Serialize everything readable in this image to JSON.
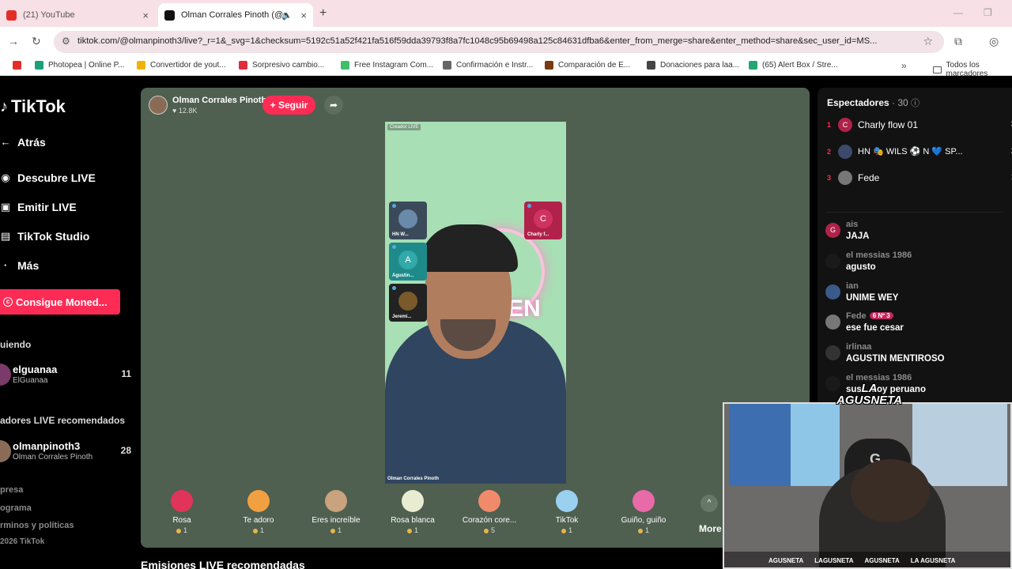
{
  "browser": {
    "tabs": [
      {
        "title": "(21) YouTube",
        "close": "×"
      },
      {
        "title": "Olman Corrales Pinoth (@o",
        "close": "×",
        "audio_icon": "speaker-icon"
      }
    ],
    "new_tab": "+",
    "window_controls": {
      "minimize": "—",
      "restore": "❐"
    },
    "url": "tiktok.com/@olmanpinoth3/live?_r=1&_svg=1&checksum=5192c51a52f421fa516f59dda39793f8a7fc1048c95b69498a125c84631dfba6&enter_from_merge=share&enter_method=share&sec_user_id=MS...",
    "bookmarks": [
      {
        "label": "",
        "color": "#e52d27",
        "icon": "youtube-icon"
      },
      {
        "label": "Photopea | Online P...",
        "color": "#1aa179"
      },
      {
        "label": "Convertidor de yout...",
        "color": "#f0b400"
      },
      {
        "label": "Sorpresivo cambio...",
        "color": "#e12c3c"
      },
      {
        "label": "Free Instagram Com...",
        "color": "#3fbf6a"
      },
      {
        "label": "Confirmación e Instr...",
        "color": "#666666"
      },
      {
        "label": "Comparación de E...",
        "color": "#7a3b10"
      },
      {
        "label": "Donaciones para laa...",
        "color": "#444444"
      },
      {
        "label": "(65) Alert Box / Stre...",
        "color": "#23a574"
      }
    ],
    "bookmarks_more": "»",
    "bookmarks_folder": "Todos los marcadores"
  },
  "sidebar": {
    "logo": "TikTok",
    "nav": [
      {
        "label": "Atrás",
        "icon": "arrow-left-icon"
      },
      {
        "label": "Descubre LIVE",
        "icon": "live-icon"
      },
      {
        "label": "Emitir LIVE",
        "icon": "camera-icon"
      },
      {
        "label": "TikTok Studio",
        "icon": "studio-icon"
      },
      {
        "label": "Más",
        "icon": "more-icon"
      }
    ],
    "coins_button": "Consigue Moned...",
    "following_title": "uiendo",
    "following": [
      {
        "name": "elguanaa",
        "handle": "ElGuanaa",
        "count": "11"
      }
    ],
    "recommended_title": "adores LIVE recomendados",
    "recommended": [
      {
        "name": "olmanpinoth3",
        "handle": "Olman Corrales Pinoth",
        "count": "28"
      }
    ],
    "footer": [
      "presa",
      "ograma",
      "rminos y políticas",
      "2026 TikTok"
    ]
  },
  "live": {
    "host_name": "Olman Corrales Pinoth",
    "likes": "♥ 12.8K",
    "follow_label": "+ Seguir",
    "stream_badge": "Creador LIVE",
    "stream_caption": "Olman Corrales Pinoth",
    "brand_text": "MEN",
    "guests": [
      {
        "label": "HN W...",
        "initial": "",
        "color": "#3b4a5a"
      },
      {
        "label": "Charly f...",
        "initial": "C",
        "color": "#b0224a"
      },
      {
        "label": "Agustin...",
        "initial": "A",
        "color": "#1f8a8a"
      },
      {
        "label": "Jeremi...",
        "initial": "",
        "color": "#222222"
      }
    ],
    "gifts": [
      {
        "name": "Rosa",
        "price": "1",
        "color": "#e0345a"
      },
      {
        "name": "Te adoro",
        "price": "1",
        "color": "#f0a040"
      },
      {
        "name": "Eres increíble",
        "price": "1",
        "color": "#c9a27e"
      },
      {
        "name": "Rosa blanca",
        "price": "1",
        "color": "#e8ecd0"
      },
      {
        "name": "Corazón core...",
        "price": "5",
        "color": "#f08a6a"
      },
      {
        "name": "TikTok",
        "price": "1",
        "color": "#9ad0f0"
      },
      {
        "name": "Guiño, guiño",
        "price": "1",
        "color": "#e86aa8"
      }
    ],
    "gifts_up": "^",
    "gifts_more": "More",
    "recommended_title": "Emisiones LIVE recomendadas"
  },
  "viewers": {
    "title": "Espectadores",
    "count": "· 30",
    "top": [
      {
        "rank": "1",
        "name": "Charly flow 01",
        "initial": "C",
        "color": "#b0224a",
        "score": "3"
      },
      {
        "rank": "2",
        "name": "HN 🎭 WILS ⚽ N 💙 SP...",
        "initial": "",
        "color": "#3b4a6a",
        "score": "2"
      },
      {
        "rank": "3",
        "name": "Fede",
        "initial": "",
        "color": "#777777",
        "score": "1"
      }
    ],
    "chat": [
      {
        "user": "ais",
        "text": "JAJA",
        "initial": "G",
        "color": "#b0224a",
        "badge": ""
      },
      {
        "user": "el messias 1986",
        "text": "agusto",
        "initial": "",
        "color": "#1a1a1a",
        "badge": ""
      },
      {
        "user": "ian",
        "text": "UNIME WEY",
        "initial": "",
        "color": "#3a5a8a",
        "badge": ""
      },
      {
        "user": "Fede",
        "text": "ese fue cesar",
        "initial": "",
        "color": "#777777",
        "badge": "6 Nº 3"
      },
      {
        "user": "irlinaa",
        "text": "AGUSTIN MENTIROSO",
        "initial": "",
        "color": "#333333",
        "badge": ""
      },
      {
        "user": "el messias 1986",
        "text": "sus... soy peruano",
        "initial": "",
        "color": "#1a1a1a",
        "badge": ""
      }
    ]
  },
  "webcam": {
    "logo_line1": "LA",
    "logo_line2": "AGUSNETA",
    "social": [
      "AGUSNETA",
      "LAGUSNETA",
      "AGUSNETA",
      "LA AGUSNETA"
    ]
  }
}
